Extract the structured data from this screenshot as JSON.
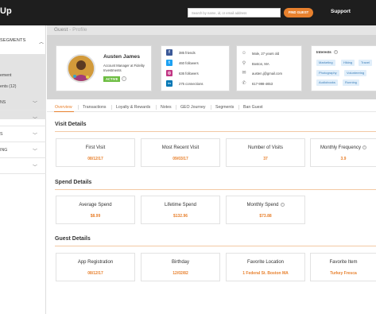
{
  "topbar": {
    "brand": "Up",
    "search_placeholder": "Search by name, id, or email address",
    "find_button": "FIND GUEST",
    "support": "Support"
  },
  "sidebar": {
    "header": "SEGMENTS",
    "active_sub_1": "ement",
    "active_sub_2": "ents (12)",
    "items": [
      "NS",
      "",
      "S",
      "ING",
      ""
    ]
  },
  "page": {
    "title": "Guest",
    "subtitle": "- Profile"
  },
  "profile": {
    "name": "Austen James",
    "role": "Account Manager at Fidelity Investments",
    "status": "ACTIVE"
  },
  "social": [
    {
      "icon": "facebook-icon",
      "text": "385 friends",
      "color": "#3b5998",
      "glyph": "f"
    },
    {
      "icon": "twitter-icon",
      "text": "460 followers",
      "color": "#1da1f2",
      "glyph": "t"
    },
    {
      "icon": "instagram-icon",
      "text": "636 followers",
      "color": "#c13584",
      "glyph": "◎"
    },
    {
      "icon": "linkedin-icon",
      "text": "275 connections",
      "color": "#0077b5",
      "glyph": "in"
    }
  ],
  "contact": [
    {
      "icon": "person-icon",
      "glyph": "☺",
      "text": "Male, 27 years old"
    },
    {
      "icon": "location-pin-icon",
      "glyph": "⚲",
      "text": "Boston, MA"
    },
    {
      "icon": "email-icon",
      "glyph": "✉",
      "text": "austen.j@gmail.com"
    },
    {
      "icon": "phone-icon",
      "glyph": "✆",
      "text": "617-998-4653"
    }
  ],
  "interests": {
    "title": "Interests",
    "tags": [
      "Marketing",
      "Hiking",
      "Travel",
      "Photography",
      "Volunteering",
      "Audiobooks",
      "Running"
    ]
  },
  "tabs": [
    "Overview",
    "Transactions",
    "Loyalty & Rewards",
    "Notes",
    "GEO Journey",
    "Segments",
    "Ban Guest"
  ],
  "sections": {
    "guest_details": {
      "title": "Visit Details",
      "stats": [
        {
          "label": "First Visit",
          "value": "08/12/17"
        },
        {
          "label": "Most Recent Visit",
          "value": "09/03/17"
        },
        {
          "label": "Number of Visits",
          "value": "37"
        },
        {
          "label": "Monthly Frequency",
          "value": "3.9"
        }
      ]
    },
    "spend_details": {
      "title": "Spend Details",
      "stats": [
        {
          "label": "Average Spend",
          "value": "$8.99"
        },
        {
          "label": "Lifetime Spend",
          "value": "$132.96"
        },
        {
          "label": "Monthly Spend",
          "value": "$73.88"
        }
      ]
    },
    "more_details": {
      "title": "Guest Details",
      "stats": [
        {
          "label": "App Registration",
          "value": "08/12/17"
        },
        {
          "label": "Birthday",
          "value": "12/02/82"
        },
        {
          "label": "Favorite Location",
          "value": "1 Federal St. Boston MA"
        },
        {
          "label": "Favorite Item",
          "value": "Turkey Fresca"
        }
      ]
    }
  },
  "colors": {
    "accent": "#e8812e",
    "active_green": "#6dbd42",
    "tag_blue": "#3d7fb8"
  }
}
